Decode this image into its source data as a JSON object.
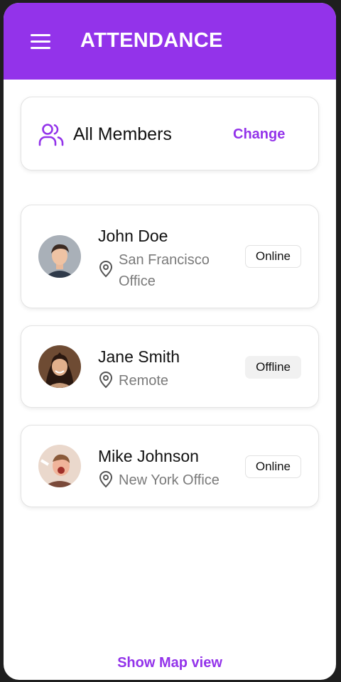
{
  "header": {
    "title": "ATTENDANCE",
    "background": "#9333ea",
    "menu_icon": "hamburger-menu-icon"
  },
  "filter": {
    "icon": "users-icon",
    "label": "All Members",
    "action_label": "Change"
  },
  "members": [
    {
      "name": "John Doe",
      "location": "San Francisco Office",
      "status": "Online"
    },
    {
      "name": "Jane Smith",
      "location": "Remote",
      "status": "Offline"
    },
    {
      "name": "Mike Johnson",
      "location": "New York Office",
      "status": "Online"
    }
  ],
  "footer": {
    "map_link": "Show Map view"
  },
  "colors": {
    "accent": "#9333ea",
    "text": "#111111",
    "muted": "#7a7a7a"
  }
}
